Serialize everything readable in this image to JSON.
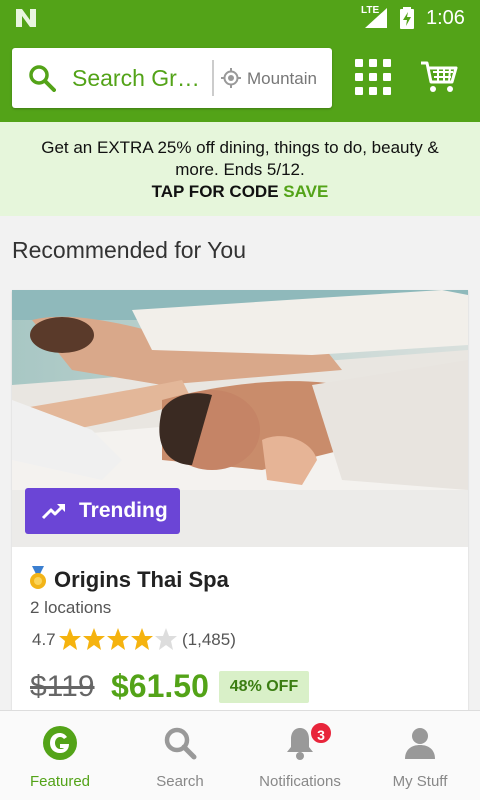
{
  "status_bar": {
    "network": "LTE",
    "time": "1:06"
  },
  "header": {
    "search_placeholder": "Search Gr…",
    "location": "Mountain"
  },
  "promo": {
    "text": "Get an EXTRA 25% off dining, things to do, beauty & more. Ends 5/12.",
    "tap_label": "TAP FOR CODE",
    "code": "SAVE"
  },
  "section": {
    "title": "Recommended for You"
  },
  "deal": {
    "badge": "Trending",
    "title": "Origins Thai Spa",
    "locations": "2 locations",
    "rating": "4.7",
    "rating_count": "(1,485)",
    "rating_value": 4.7,
    "old_price": "$119",
    "new_price": "$61.50",
    "discount": "48% OFF"
  },
  "bottom_nav": {
    "items": [
      {
        "label": "Featured",
        "icon": "groupon-g-icon",
        "active": true
      },
      {
        "label": "Search",
        "icon": "search-icon"
      },
      {
        "label": "Notifications",
        "icon": "bell-icon",
        "badge": "3"
      },
      {
        "label": "My Stuff",
        "icon": "person-icon"
      }
    ]
  },
  "colors": {
    "brand_green": "#53a318",
    "trending_purple": "#6b45d6",
    "badge_red": "#e8253b",
    "star": "#f5b30f"
  }
}
